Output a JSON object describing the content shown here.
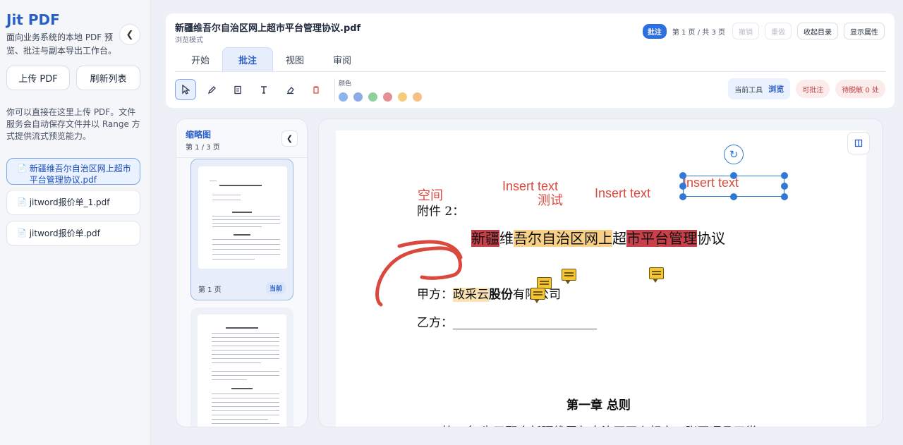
{
  "sidebar": {
    "title": "Jit PDF",
    "desc": "面向业务系统的本地 PDF 预览、批注与副本导出工作台。",
    "upload_label": "上传 PDF",
    "refresh_label": "刷新列表",
    "note": "你可以直接在这里上传 PDF。文件服务会自动保存文件并以 Range 方式提供流式预览能力。",
    "collapse_icon": "chevron-left-icon",
    "files": [
      {
        "name": "新疆维吾尔自治区网上超市平台管理协议.pdf",
        "active": true
      },
      {
        "name": "jitword报价单_1.pdf",
        "active": false
      },
      {
        "name": "jitword报价单.pdf",
        "active": false
      }
    ]
  },
  "header": {
    "doc_title": "新疆维吾尔自治区网上超市平台管理协议.pdf",
    "mode": "浏览模式",
    "mode_badge": "批注",
    "page_info": "第 1 页 / 共 3 页",
    "undo": "撤销",
    "redo": "重做",
    "toc": "收起目录",
    "props": "显示属性"
  },
  "tabs": [
    "开始",
    "批注",
    "视图",
    "审阅"
  ],
  "toolbar": {
    "color_label": "颜色",
    "colors": [
      "#8fb3ec",
      "#8eabe7",
      "#8fcf9b",
      "#e58f92",
      "#f6cc7c",
      "#f3c088"
    ],
    "current_tool_label": "当前工具",
    "current_tool_value": "浏览",
    "annotatable": "可批注",
    "pending": "待脱敏 0 处"
  },
  "thumbs": {
    "title": "缩略图",
    "page": "第 1 / 3 页",
    "page1_label": "第 1 页",
    "current": "当前"
  },
  "pdf": {
    "ann_kongjian": "空间",
    "ann_insert1": "Insert text",
    "ann_ceshi": "测试",
    "ann_insert2": "Insert text",
    "ann_insert3": "Insert text",
    "attachment": "附件 2：",
    "title_parts": [
      "新疆",
      "维",
      "吾尔自治区网上",
      "超",
      "市平台管理",
      "协议"
    ],
    "party_a_label": "甲方：",
    "party_a_hl": "政采云",
    "party_a_bold": "股份",
    "party_a_rest": "有限公司",
    "party_b": "乙方：________________________",
    "chapter": "第一章  总则",
    "article_cut": "第一条  为了配合新疆维吾尔自治区网上超市，张国瑁品平常"
  }
}
